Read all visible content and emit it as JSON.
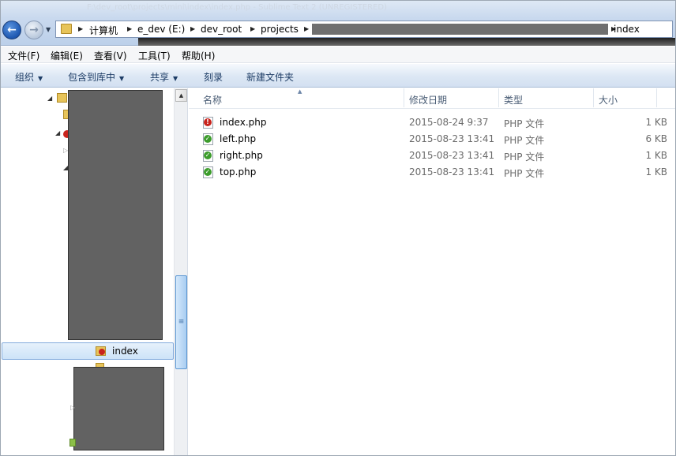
{
  "window": {
    "title_faded": "F:\\dev_root\\projects\\mini\\index\\index.php - Sublime Text 2 (UNREGISTERED)"
  },
  "address_bar": {
    "crumbs": [
      "计算机",
      "e_dev (E:)",
      "dev_root",
      "projects",
      "index"
    ]
  },
  "menu": [
    "文件(F)",
    "编辑(E)",
    "查看(V)",
    "工具(T)",
    "帮助(H)"
  ],
  "commands": [
    "组织",
    "包含到库中",
    "共享",
    "刻录",
    "新建文件夹"
  ],
  "tree": {
    "selected_label": "index"
  },
  "columns": [
    "名称",
    "修改日期",
    "类型",
    "大小"
  ],
  "files": [
    {
      "name": "index.php",
      "date": "2015-08-24 9:37",
      "type": "PHP 文件",
      "size": "1 KB",
      "status": "error"
    },
    {
      "name": "left.php",
      "date": "2015-08-23 13:41",
      "type": "PHP 文件",
      "size": "6 KB",
      "status": "ok"
    },
    {
      "name": "right.php",
      "date": "2015-08-23 13:41",
      "type": "PHP 文件",
      "size": "1 KB",
      "status": "ok"
    },
    {
      "name": "top.php",
      "date": "2015-08-23 13:41",
      "type": "PHP 文件",
      "size": "1 KB",
      "status": "ok"
    }
  ],
  "colors": {
    "selection": "#cde3f8",
    "error_badge": "#c8231c",
    "ok_badge": "#3c9c2c"
  }
}
